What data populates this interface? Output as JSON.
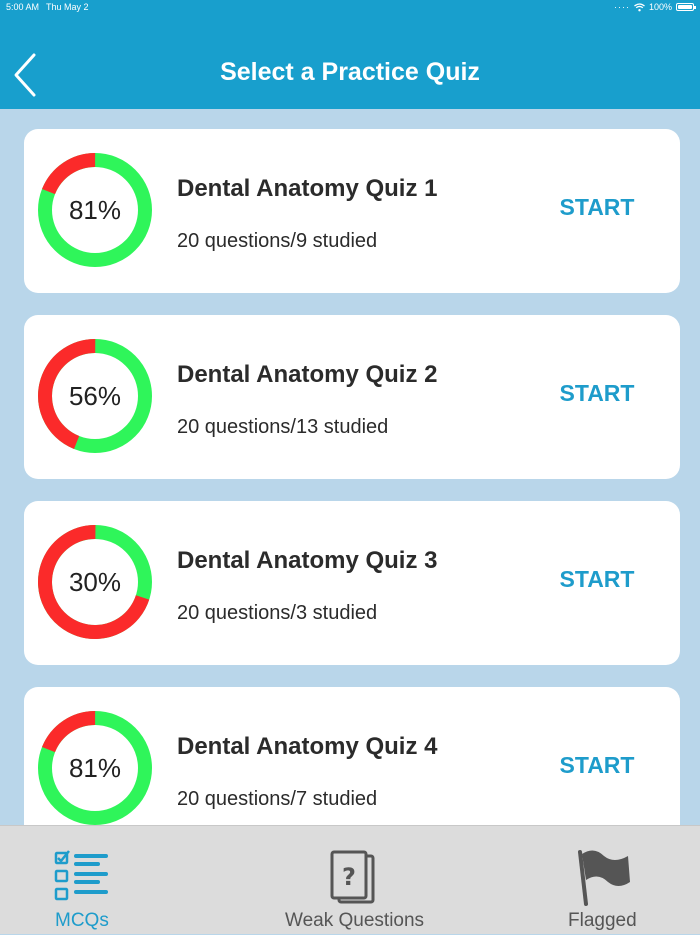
{
  "status_bar": {
    "time": "5:00 AM",
    "date": "Thu May 2",
    "battery": "100%"
  },
  "header": {
    "title": "Select a Practice Quiz",
    "back_icon": "chevron-left-icon"
  },
  "quizzes": [
    {
      "title": "Dental Anatomy Quiz 1",
      "subtitle": "20 questions/9 studied",
      "percent_label": "81%",
      "score": 0.81,
      "start_label": "START"
    },
    {
      "title": "Dental Anatomy Quiz 2",
      "subtitle": "20 questions/13 studied",
      "percent_label": "56%",
      "score": 0.56,
      "start_label": "START"
    },
    {
      "title": "Dental Anatomy Quiz 3",
      "subtitle": "20 questions/3 studied",
      "percent_label": "30%",
      "score": 0.3,
      "start_label": "START"
    },
    {
      "title": "Dental Anatomy Quiz 4",
      "subtitle": "20 questions/7 studied",
      "percent_label": "81%",
      "score": 0.81,
      "start_label": "START"
    }
  ],
  "tabs": [
    {
      "label": "MCQs",
      "icon": "checklist-icon",
      "active": true
    },
    {
      "label": "Weak Questions",
      "icon": "question-cards-icon",
      "active": false
    },
    {
      "label": "Flagged",
      "icon": "flag-icon",
      "active": false
    }
  ],
  "colors": {
    "header": "#189fcd",
    "background": "#b9d6ea",
    "correct": "#2ff55a",
    "incorrect": "#fb2a2a",
    "accent": "#1e9ccb",
    "inactive_tab": "#555555"
  }
}
